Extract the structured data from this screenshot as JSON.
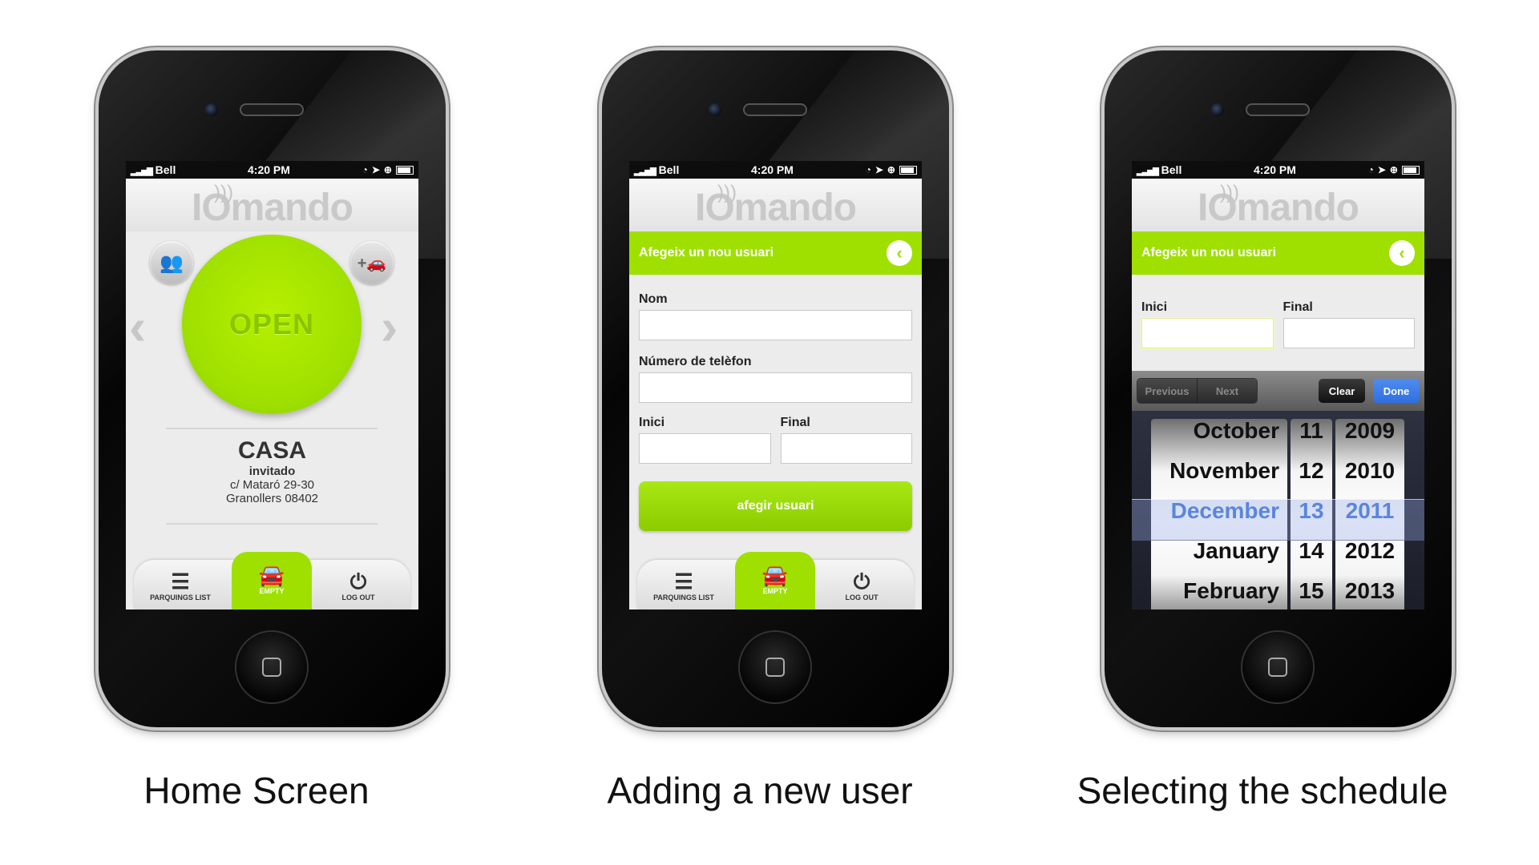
{
  "status": {
    "carrier": "Bell",
    "time": "4:20 PM"
  },
  "logo": "IOmando",
  "screen1": {
    "open_label": "OPEN",
    "location_name": "CASA",
    "role": "invitado",
    "address_line1": "c/ Mataró 29-30",
    "address_line2": "Granollers 08402"
  },
  "tabs": {
    "list": "PARQUINGS LIST",
    "empty": "EMPTY",
    "logout": "LOG OUT"
  },
  "screen2": {
    "header": "Afegeix un nou usuari",
    "name_label": "Nom",
    "phone_label": "Número de telèfon",
    "start_label": "Inici",
    "end_label": "Final",
    "submit": "afegir usuari"
  },
  "screen3": {
    "header": "Afegeix un nou usuari",
    "start_label": "Inici",
    "end_label": "Final",
    "toolbar": {
      "previous": "Previous",
      "next": "Next",
      "clear": "Clear",
      "done": "Done"
    },
    "months": [
      "October",
      "November",
      "December",
      "January",
      "February"
    ],
    "days": [
      "11",
      "12",
      "13",
      "14",
      "15"
    ],
    "years": [
      "2009",
      "2010",
      "2011",
      "2012",
      "2013"
    ]
  },
  "captions": {
    "one": "Home Screen",
    "two": "Adding a new user",
    "three": "Selecting the schedule"
  },
  "colors": {
    "accent": "#9fe000",
    "done": "#2f6fe0",
    "picker_selected": "#3b74d8"
  }
}
